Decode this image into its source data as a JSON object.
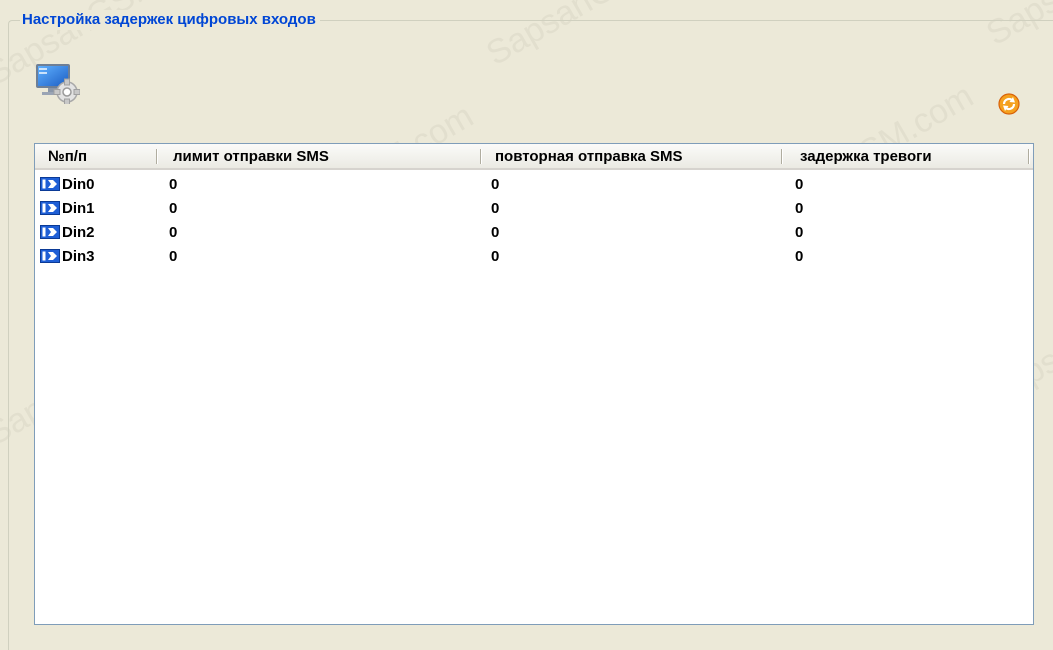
{
  "group_title": "Настройка задержек цифровых входов",
  "icons": {
    "settings": "monitor-gear-icon",
    "refresh": "refresh-icon"
  },
  "colors": {
    "title": "#0046d5",
    "refresh": "#f07a10",
    "list_border": "#7f9db9"
  },
  "table": {
    "columns": [
      "№п/п",
      "лимит отправки SMS",
      "повторная отправка SMS",
      "задержка тревоги"
    ],
    "rows": [
      {
        "name": "Din0",
        "sms_limit": "0",
        "sms_repeat": "0",
        "alarm_delay": "0"
      },
      {
        "name": "Din1",
        "sms_limit": "0",
        "sms_repeat": "0",
        "alarm_delay": "0"
      },
      {
        "name": "Din2",
        "sms_limit": "0",
        "sms_repeat": "0",
        "alarm_delay": "0"
      },
      {
        "name": "Din3",
        "sms_limit": "0",
        "sms_repeat": "0",
        "alarm_delay": "0"
      }
    ]
  },
  "watermark": "SapsanGSM.com"
}
